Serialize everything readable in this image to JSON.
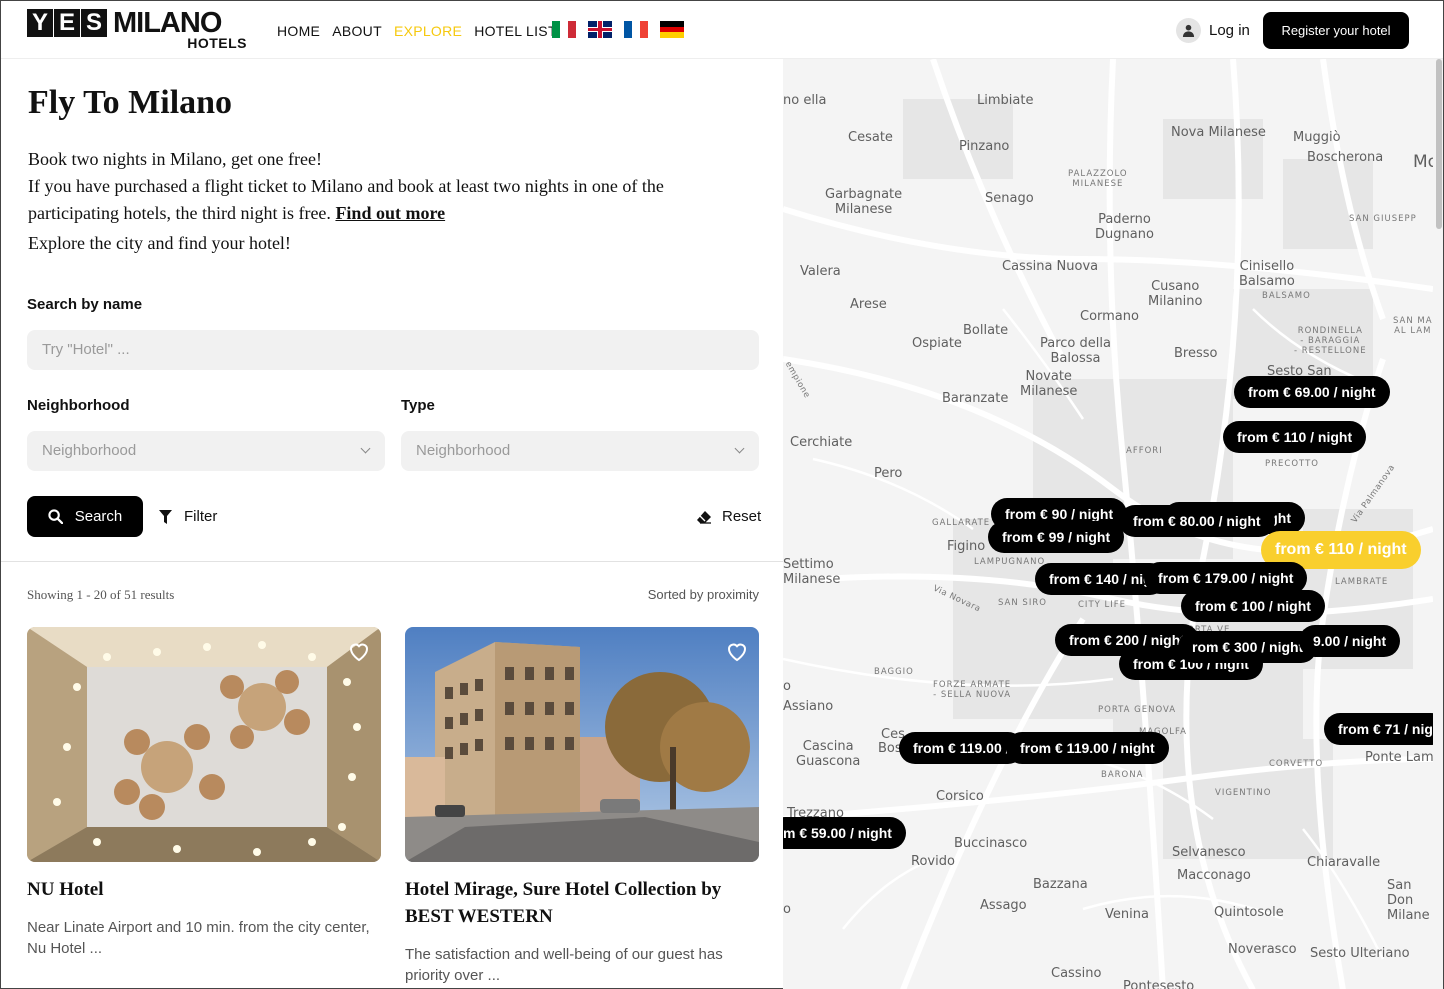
{
  "brand": {
    "yes": [
      "Y",
      "E",
      "S"
    ],
    "milano": "MILANO",
    "hotels": "HOTELS"
  },
  "nav": [
    {
      "label": "HOME",
      "active": false
    },
    {
      "label": "ABOUT",
      "active": false
    },
    {
      "label": "EXPLORE",
      "active": true
    },
    {
      "label": "HOTEL LIST",
      "active": false
    }
  ],
  "languages": [
    "italian-flag",
    "uk-flag",
    "french-flag",
    "german-flag"
  ],
  "account": {
    "login_label": "Log in",
    "register_label": "Register your hotel"
  },
  "intro": {
    "title": "Fly To Milano",
    "line1": "Book two nights in Milano, get one free!",
    "line2": "If you have purchased a flight ticket to Milano and book at least two nights in one of the participating hotels, the third night is free.",
    "link": "Find out more",
    "line3": "Explore the city and find your hotel!"
  },
  "search": {
    "name_label": "Search by name",
    "name_placeholder": "Try \"Hotel\" ...",
    "neighborhood_label": "Neighborhood",
    "neighborhood_value": "Neighborhood",
    "type_label": "Type",
    "type_value": "Neighborhood",
    "search_label": "Search",
    "filter_label": "Filter",
    "reset_label": "Reset"
  },
  "results": {
    "showing": "Showing 1 - 20 of 51 results",
    "sorted": "Sorted by proximity"
  },
  "hotels": [
    {
      "name": "NU Hotel",
      "desc": "Near Linate Airport and 10 min. from the city center, Nu Hotel ..."
    },
    {
      "name": "Hotel Mirage, Sure Hotel Collection by BEST WESTERN",
      "desc": "The satisfaction and well-being of our guest has priority over ..."
    }
  ],
  "map": {
    "places": [
      "no\nella",
      "Limbiate",
      "Cesate",
      "Pinzano",
      "Nova Milanese",
      "Muggiò",
      "Boscherona",
      "Mo",
      "Garbagnate\nMilanese",
      "Senago",
      "Paderno\nDugnano",
      "Cassina Nuova",
      "Cinisello\nBalsamo",
      "Cusano\nMilanino",
      "Valera",
      "Arese",
      "Cormano",
      "Bollate",
      "Ospiate",
      "Parco della\nBalossa",
      "Bresso",
      "Sesto San",
      "Novate\nMilanese",
      "Baranzate",
      "Cerchiate",
      "Pero",
      "Figino",
      "Settimo\nMilanese",
      "Cascina\nGuascona",
      "Corsico",
      "Rovido",
      "Buccinasco",
      "Bazzana",
      "Assago",
      "Venina",
      "Selvanesco",
      "Macconago",
      "Quintosole",
      "Noverasco",
      "Sesto Ulteriano",
      "Chiaravalle",
      "San Don\nMilane",
      "Cassino",
      "Trezzano",
      "Pontesesto",
      "Ponte Lam",
      "o",
      "Assiano",
      "Ces",
      "Bos",
      "o"
    ],
    "districts": [
      "PALAZZOLO\nMILANESE",
      "SAN GIUSEPP",
      "BALSAMO",
      "RONDINELLA\n- BARAGGIA\n- RESTELLONE",
      "SAN MA\nAL LAM",
      "AFFORI",
      "PRECOTTO",
      "GALLARATE",
      "LAMPUGNANO",
      "SAN SIRO",
      "CITY LIFE",
      "PORTA VE",
      "LAMBRATE",
      "BAGGIO",
      "FORZE ARMATE\n- SELLA NUOVA",
      "PORTA GENOVA",
      "MAGOLFA",
      "BARONA",
      "CORVETTO",
      "VIGENTINO"
    ],
    "roads": [
      "Via Novara",
      "Via Palmanova",
      "empione"
    ],
    "prices": [
      "from € 69.00 / night",
      "from € 110 / night",
      "from € 90 / night",
      "from € 99 / night",
      "night",
      "from € 80.00 / night",
      "from € 110 / night",
      "from € 140 / nig",
      "from € 179.00 / night",
      "from € 100 / night",
      "from € 200 / night",
      "rom € 300 / night",
      "9.00 / night",
      "from € 100 / night",
      "from € 71 / nig",
      "from € 119.00 /",
      "from € 119.00 / night",
      "m € 59.00 / night"
    ]
  },
  "colors": {
    "accent": "#f9cf2d",
    "black": "#000000",
    "map_bg": "#f4f4f4"
  }
}
